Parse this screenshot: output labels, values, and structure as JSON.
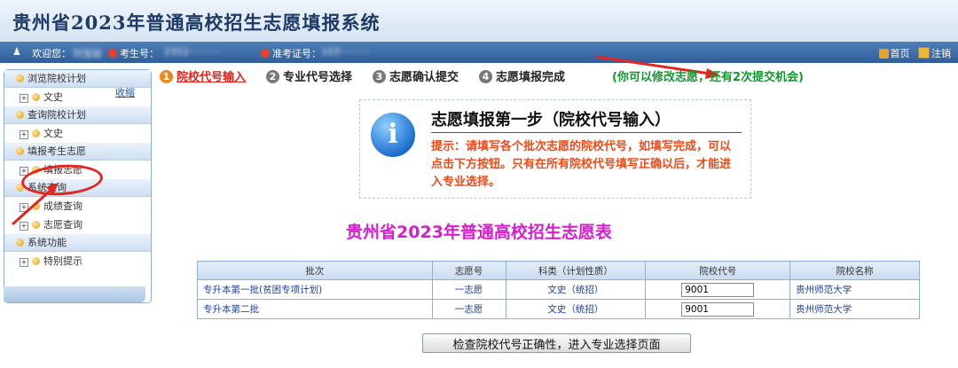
{
  "header": {
    "title": "贵州省2023年普通高校招生志愿填报系统"
  },
  "userbar": {
    "welcome": "欢迎您：",
    "name": "刘宝娃",
    "exam_label": "考生号：",
    "exam_no": "2352··········",
    "cert_label": "准考证号：",
    "cert_no": "103··········",
    "home": "首页",
    "logout": "注销"
  },
  "sidebar": {
    "collapse": "收缩",
    "sections": [
      {
        "title": "浏览院校计划",
        "items": [
          "文史"
        ]
      },
      {
        "title": "查询院校计划",
        "items": [
          "文史"
        ]
      },
      {
        "title": "填报考生志愿",
        "items": [
          "填报志愿"
        ]
      },
      {
        "title": "系统查询",
        "items": [
          "成绩查询",
          "志愿查询"
        ]
      },
      {
        "title": "系统功能",
        "items": [
          "特别提示"
        ]
      }
    ]
  },
  "steps": [
    {
      "num": "1",
      "label": "院校代号输入"
    },
    {
      "num": "2",
      "label": "专业代号选择"
    },
    {
      "num": "3",
      "label": "志愿确认提交"
    },
    {
      "num": "4",
      "label": "志愿填报完成"
    }
  ],
  "hint": "(你可以修改志愿，还有2次提交机会)",
  "info": {
    "title": "志愿填报第一步（院校代号输入）",
    "text": "提示：请填写各个批次志愿的院校代号，如填写完成，可以点击下方按钮。只有在所有院校代号填写正确以后，才能进入专业选择。"
  },
  "form_title": "贵州省2023年普通高校招生志愿表",
  "table": {
    "headers": [
      "批次",
      "志愿号",
      "科类（计划性质）",
      "院校代号",
      "院校名称"
    ],
    "rows": [
      {
        "batch": "专升本第一批(贫困专项计划)",
        "choice": "一志愿",
        "category": "文史（统招）",
        "code": "9001",
        "school": "贵州师范大学"
      },
      {
        "batch": "专升本第二批",
        "choice": "一志愿",
        "category": "文史（统招）",
        "code": "9001",
        "school": "贵州师范大学"
      }
    ]
  },
  "check_button": "检查院校代号正确性，进入专业选择页面",
  "colors": {
    "accent_red": "#e0221a",
    "hint_green": "#12982c",
    "title_magenta": "#d41ecf",
    "tip_orange": "#ef4a16"
  }
}
